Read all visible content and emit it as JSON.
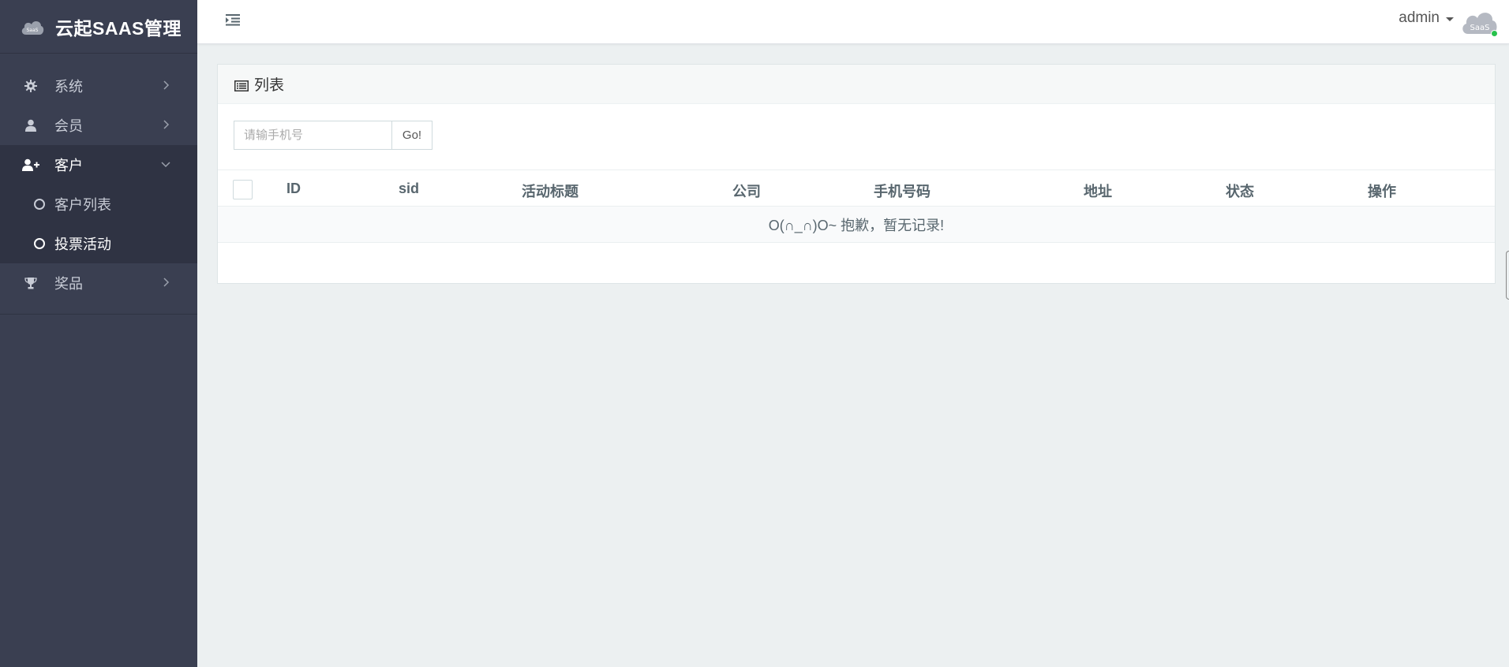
{
  "brand": {
    "title": "云起SAAS管理",
    "logo_text": "SaaS"
  },
  "sidebar": {
    "items": [
      {
        "label": "系统",
        "icon": "gear-icon"
      },
      {
        "label": "会员",
        "icon": "user-icon"
      },
      {
        "label": "客户",
        "icon": "user-plus-icon",
        "open": true,
        "children": [
          {
            "label": "客户列表"
          },
          {
            "label": "投票活动",
            "active": true
          }
        ]
      },
      {
        "label": "奖品",
        "icon": "trophy-icon"
      }
    ]
  },
  "header": {
    "username": "admin",
    "avatar_text": "SaaS"
  },
  "panel": {
    "title": "列表",
    "search": {
      "placeholder": "请输手机号",
      "button_label": "Go!"
    },
    "table": {
      "columns": [
        "ID",
        "sid",
        "活动标题",
        "公司",
        "手机号码",
        "地址",
        "状态",
        "操作"
      ],
      "empty_text": "O(∩_∩)O~ 抱歉，暂无记录!"
    }
  },
  "colors": {
    "sidebar_bg": "#3a3f51",
    "content_bg": "#ecf0f1",
    "status_online": "#27c24c"
  }
}
